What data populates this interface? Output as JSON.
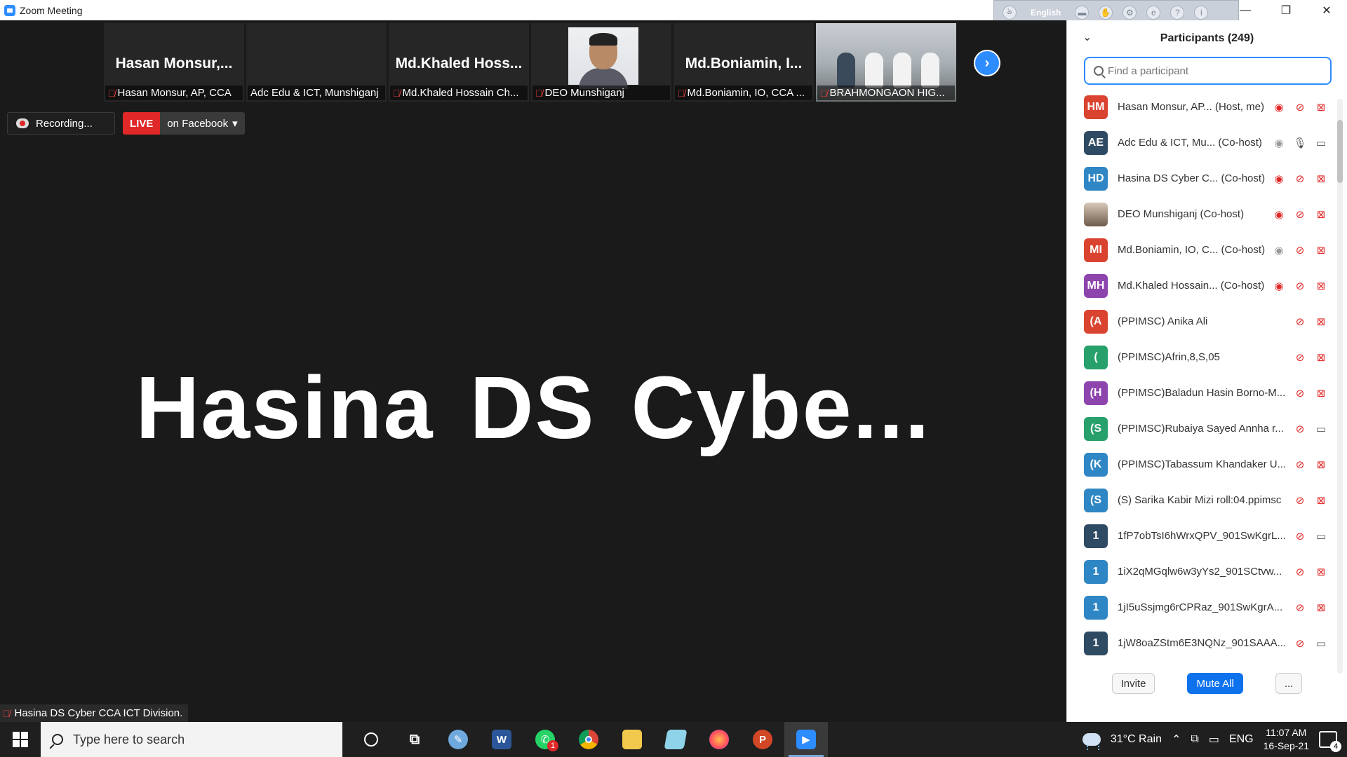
{
  "window": {
    "title": "Zoom Meeting",
    "minimize_glyph": "—",
    "restore_glyph": "❐",
    "close_glyph": "✕"
  },
  "language_bar": {
    "language": "English"
  },
  "thumbnails": [
    {
      "big_name": "Hasan  Monsur,...",
      "label": "Hasan Monsur, AP, CCA",
      "muted": true
    },
    {
      "big_name": "",
      "label": "Adc Edu & ICT, Munshiganj",
      "muted": false
    },
    {
      "big_name": "Md.Khaled  Hoss...",
      "label": "Md.Khaled Hossain Ch...",
      "muted": true
    },
    {
      "big_name": "",
      "label": "DEO Munshiganj",
      "muted": true,
      "has_photo": true
    },
    {
      "big_name": "Md.Boniamin,  I...",
      "label": "Md.Boniamin, IO, CCA ...",
      "muted": true
    },
    {
      "big_name": "",
      "label": "BRAHMONGAON HIG...",
      "muted": true,
      "has_video": true
    }
  ],
  "recording": {
    "label": "Recording..."
  },
  "live": {
    "badge": "LIVE",
    "target": "on Facebook"
  },
  "speaker": {
    "display_name": "Hasina  DS  Cybe...",
    "name_label": "Hasina DS Cyber CCA ICT Division."
  },
  "panel": {
    "title": "Participants (249)",
    "search_placeholder": "Find a participant",
    "invite_label": "Invite",
    "mute_all_label": "Mute All",
    "more_label": "..."
  },
  "participants": [
    {
      "initials": "HM",
      "color": "#d9432f",
      "name": "Hasan Monsur, AP...  (Host, me)",
      "rec": "red",
      "mic": "off",
      "video": "off"
    },
    {
      "initials": "AE",
      "color": "#2f4a63",
      "name": "Adc Edu & ICT, Mu...  (Co-host)",
      "rec": "grey",
      "mic": "on",
      "video": "on"
    },
    {
      "initials": "HD",
      "color": "#2f86c4",
      "name": "Hasina DS Cyber C...  (Co-host)",
      "rec": "red",
      "mic": "off",
      "video": "off"
    },
    {
      "initials": "",
      "color": "photo",
      "name": "DEO Munshiganj (Co-host)",
      "rec": "red",
      "mic": "off",
      "video": "off"
    },
    {
      "initials": "MI",
      "color": "#d9432f",
      "name": "Md.Boniamin, IO, C...  (Co-host)",
      "rec": "grey",
      "mic": "off",
      "video": "off"
    },
    {
      "initials": "MH",
      "color": "#8e44ad",
      "name": "Md.Khaled Hossain...  (Co-host)",
      "rec": "red",
      "mic": "off",
      "video": "off"
    },
    {
      "initials": "(A",
      "color": "#d9432f",
      "name": "(PPIMSC) Anika Ali",
      "rec": "",
      "mic": "off",
      "video": "off"
    },
    {
      "initials": "(",
      "color": "#27a06b",
      "name": "(PPIMSC)Afrin,8,S,05",
      "rec": "",
      "mic": "off",
      "video": "off"
    },
    {
      "initials": "(H",
      "color": "#8e44ad",
      "name": "(PPIMSC)Baladun Hasin Borno-M...",
      "rec": "",
      "mic": "off",
      "video": "off"
    },
    {
      "initials": "(S",
      "color": "#27a06b",
      "name": "(PPIMSC)Rubaiya Sayed Annha r...",
      "rec": "",
      "mic": "off",
      "video": "on"
    },
    {
      "initials": "(K",
      "color": "#2f86c4",
      "name": "(PPIMSC)Tabassum Khandaker U...",
      "rec": "",
      "mic": "off",
      "video": "off"
    },
    {
      "initials": "(S",
      "color": "#2f86c4",
      "name": "(S) Sarika Kabir Mizi roll:04.ppimsc",
      "rec": "",
      "mic": "off",
      "video": "off"
    },
    {
      "initials": "1",
      "color": "#2f4a63",
      "name": "1fP7obTsI6hWrxQPV_901SwKgrL...",
      "rec": "",
      "mic": "off",
      "video": "on"
    },
    {
      "initials": "1",
      "color": "#2f86c4",
      "name": "1iX2qMGqlw6w3yYs2_901SCtvw...",
      "rec": "",
      "mic": "off",
      "video": "off"
    },
    {
      "initials": "1",
      "color": "#2f86c4",
      "name": "1jI5uSsjmg6rCPRaz_901SwKgrA...",
      "rec": "",
      "mic": "off",
      "video": "off"
    },
    {
      "initials": "1",
      "color": "#2f4a63",
      "name": "1jW8oaZStm6E3NQNz_901SAAA...",
      "rec": "",
      "mic": "off",
      "video": "on"
    }
  ],
  "taskbar": {
    "search_placeholder": "Type here to search",
    "whatsapp_badge": "1",
    "weather": "31°C  Rain",
    "language": "ENG",
    "time": "11:07 AM",
    "date": "16-Sep-21",
    "notification_count": "4"
  }
}
